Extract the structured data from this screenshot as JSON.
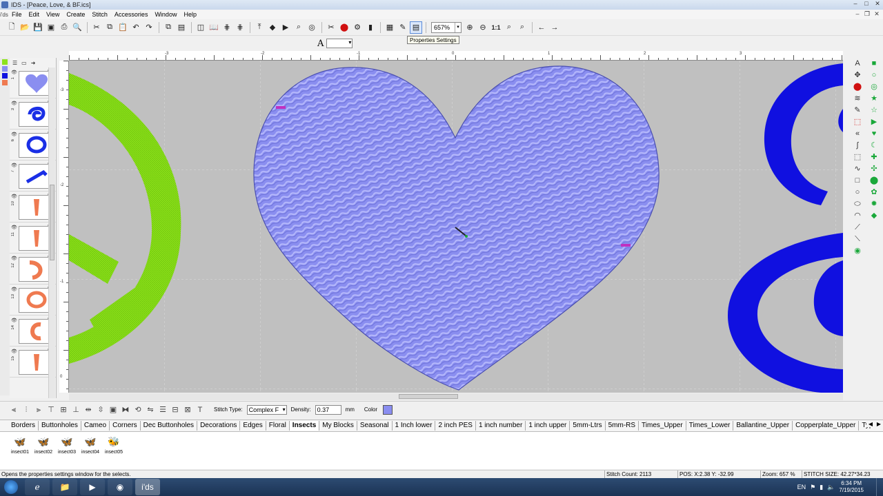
{
  "window": {
    "title": "IDS - [Peace, Love, & BF.ics]",
    "app_short": "i'ds"
  },
  "menu": [
    "File",
    "Edit",
    "View",
    "Create",
    "Stitch",
    "Accessories",
    "Window",
    "Help"
  ],
  "toolbar": {
    "zoom": "657%",
    "tooltip": "Properties Settings",
    "one_to_one": "1:1"
  },
  "fontbar": {
    "font_icon": "A"
  },
  "rulers": {
    "top": [
      "-3",
      "-2",
      "-1",
      "0",
      "1",
      "2",
      "3"
    ],
    "left": [
      "-3",
      "-2",
      "-1",
      "0"
    ]
  },
  "layers": [
    {
      "num": "1",
      "shape": "heart",
      "color": "#8a8ef0"
    },
    {
      "num": "3",
      "shape": "swirl",
      "color": "#1a2fe6"
    },
    {
      "num": "6",
      "shape": "o",
      "color": "#1a2fe6"
    },
    {
      "num": "7",
      "shape": "line",
      "color": "#1a2fe6"
    },
    {
      "num": "10",
      "shape": "letter",
      "color": "#ef7a50"
    },
    {
      "num": "11",
      "shape": "letter",
      "color": "#ef7a50"
    },
    {
      "num": "12",
      "shape": "curve",
      "color": "#ef7a50"
    },
    {
      "num": "13",
      "shape": "o",
      "color": "#ef7a50"
    },
    {
      "num": "14",
      "shape": "c",
      "color": "#ef7a50"
    },
    {
      "num": "15",
      "shape": "letter",
      "color": "#ef7a50"
    }
  ],
  "colors": {
    "heart": "#8a8ef0",
    "peace": "#8de21a",
    "blue": "#1010e0",
    "canvas": "#c0c0c0",
    "green_tools": "#1aa83a"
  },
  "props": {
    "stitch_type_label": "Stitch Type:",
    "stitch_type_value": "Complex F",
    "density_label": "Density:",
    "density_value": "0.37",
    "density_unit": "mm",
    "color_label": "Color"
  },
  "tabs": [
    "Borders",
    "Buttonholes",
    "Cameo",
    "Corners",
    "Dec Buttonholes",
    "Decorations",
    "Edges",
    "Floral",
    "Insects",
    "My Blocks",
    "Seasonal",
    "1 Inch lower",
    "2 inch PES",
    "1 inch number",
    "1 inch upper",
    "5mm-Ltrs",
    "5mm-RS",
    "Times_Upper",
    "Times_Lower",
    "Ballantine_Upper",
    "Copperplate_Upper",
    "Typewriter_Up"
  ],
  "active_tab": "Insects",
  "gallery": [
    {
      "label": "insect01",
      "icon": "🦋"
    },
    {
      "label": "insect02",
      "icon": "🦋"
    },
    {
      "label": "insect03",
      "icon": "🦋"
    },
    {
      "label": "insect04",
      "icon": "🦋"
    },
    {
      "label": "insect05",
      "icon": "🐝"
    }
  ],
  "status": {
    "message": "Opens the properties  settings window for the selects.",
    "stitch_count": "Stitch Count: 2113",
    "pos": "POS: X:2.38    Y: -32.99",
    "zoom": "Zoom: 657 %",
    "stitch_size": "STITCH SIZE: 42.27*34.23"
  },
  "taskbar": {
    "lang": "EN",
    "time": "6:34 PM",
    "date": "7/19/2015",
    "ids_label": "i'ds"
  }
}
